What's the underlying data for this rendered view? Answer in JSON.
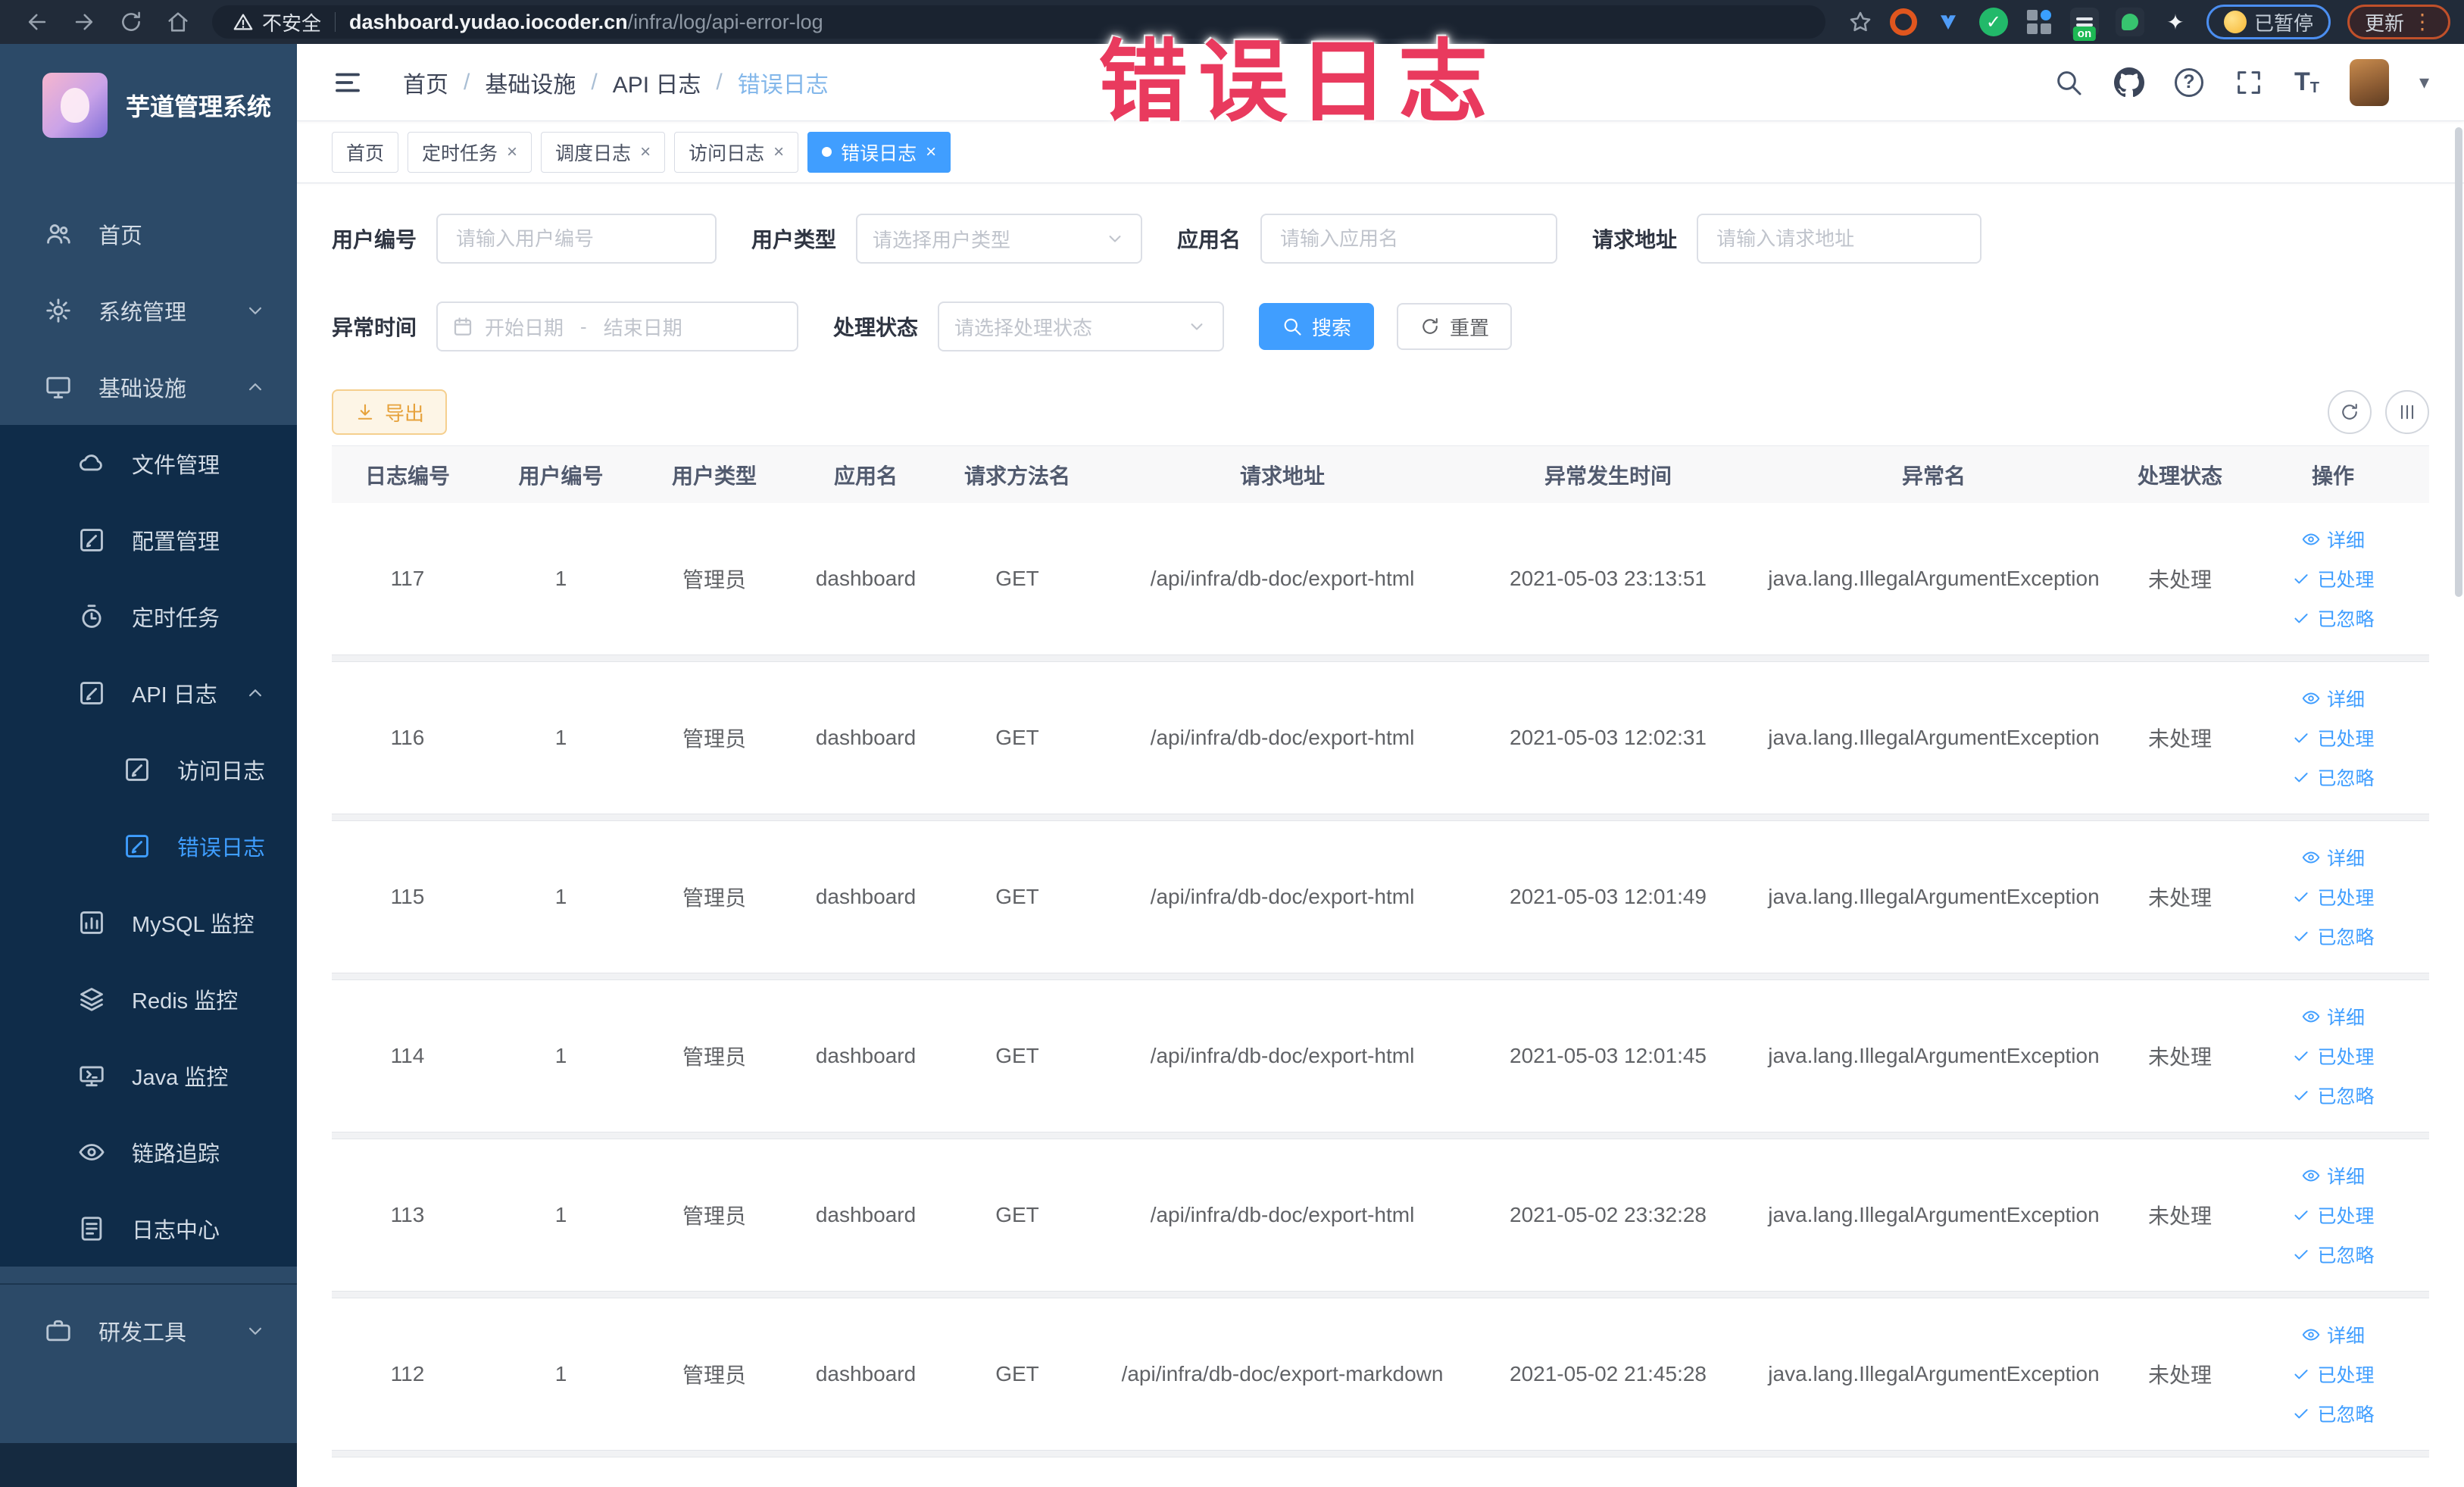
{
  "browser": {
    "security_label": "不安全",
    "url_host": "dashboard.yudao.iocoder.cn",
    "url_path": "/infra/log/api-error-log",
    "paused_label": "已暂停",
    "update_label": "更新"
  },
  "overlay": {
    "text": "错误日志",
    "color": "#e93a5e"
  },
  "app": {
    "title": "芋道管理系统"
  },
  "sidebar": {
    "items": [
      {
        "label": "首页"
      },
      {
        "label": "系统管理"
      },
      {
        "label": "基础设施"
      },
      {
        "label": "文件管理"
      },
      {
        "label": "配置管理"
      },
      {
        "label": "定时任务"
      },
      {
        "label": "API 日志"
      },
      {
        "label": "访问日志"
      },
      {
        "label": "错误日志"
      },
      {
        "label": "MySQL 监控"
      },
      {
        "label": "Redis 监控"
      },
      {
        "label": "Java 监控"
      },
      {
        "label": "链路追踪"
      },
      {
        "label": "日志中心"
      },
      {
        "label": "研发工具"
      }
    ]
  },
  "breadcrumb": {
    "items": [
      "首页",
      "基础设施",
      "API 日志",
      "错误日志"
    ]
  },
  "tabs": [
    {
      "label": "首页"
    },
    {
      "label": "定时任务"
    },
    {
      "label": "调度日志"
    },
    {
      "label": "访问日志"
    },
    {
      "label": "错误日志"
    }
  ],
  "filters": {
    "user_id_label": "用户编号",
    "user_id_placeholder": "请输入用户编号",
    "user_type_label": "用户类型",
    "user_type_placeholder": "请选择用户类型",
    "app_name_label": "应用名",
    "app_name_placeholder": "请输入应用名",
    "request_url_label": "请求地址",
    "request_url_placeholder": "请输入请求地址",
    "time_label": "异常时间",
    "time_start_placeholder": "开始日期",
    "time_separator": "-",
    "time_end_placeholder": "结束日期",
    "status_label": "处理状态",
    "status_placeholder": "请选择处理状态",
    "search_label": "搜索",
    "reset_label": "重置"
  },
  "toolbar": {
    "export_label": "导出"
  },
  "table": {
    "columns": [
      "日志编号",
      "用户编号",
      "用户类型",
      "应用名",
      "请求方法名",
      "请求地址",
      "异常发生时间",
      "异常名",
      "处理状态",
      "操作"
    ],
    "actions": [
      "详细",
      "已处理",
      "已忽略"
    ],
    "rows": [
      {
        "id": "117",
        "user_id": "1",
        "user_type": "管理员",
        "app": "dashboard",
        "method": "GET",
        "url": "/api/infra/db-doc/export-html",
        "time": "2021-05-03 23:13:51",
        "exception": "java.lang.IllegalArgumentException",
        "status": "未处理"
      },
      {
        "id": "116",
        "user_id": "1",
        "user_type": "管理员",
        "app": "dashboard",
        "method": "GET",
        "url": "/api/infra/db-doc/export-html",
        "time": "2021-05-03 12:02:31",
        "exception": "java.lang.IllegalArgumentException",
        "status": "未处理"
      },
      {
        "id": "115",
        "user_id": "1",
        "user_type": "管理员",
        "app": "dashboard",
        "method": "GET",
        "url": "/api/infra/db-doc/export-html",
        "time": "2021-05-03 12:01:49",
        "exception": "java.lang.IllegalArgumentException",
        "status": "未处理"
      },
      {
        "id": "114",
        "user_id": "1",
        "user_type": "管理员",
        "app": "dashboard",
        "method": "GET",
        "url": "/api/infra/db-doc/export-html",
        "time": "2021-05-03 12:01:45",
        "exception": "java.lang.IllegalArgumentException",
        "status": "未处理"
      },
      {
        "id": "113",
        "user_id": "1",
        "user_type": "管理员",
        "app": "dashboard",
        "method": "GET",
        "url": "/api/infra/db-doc/export-html",
        "time": "2021-05-02 23:32:28",
        "exception": "java.lang.IllegalArgumentException",
        "status": "未处理"
      },
      {
        "id": "112",
        "user_id": "1",
        "user_type": "管理员",
        "app": "dashboard",
        "method": "GET",
        "url": "/api/infra/db-doc/export-markdown",
        "time": "2021-05-02 21:45:28",
        "exception": "java.lang.IllegalArgumentException",
        "status": "未处理"
      }
    ]
  },
  "colors": {
    "accent": "#409EFF",
    "warning": "#E6A23C",
    "overlay_red": "#E93A5E",
    "sidebar_bg": "#2C4A68",
    "submenu_bg": "#0F2C49"
  }
}
